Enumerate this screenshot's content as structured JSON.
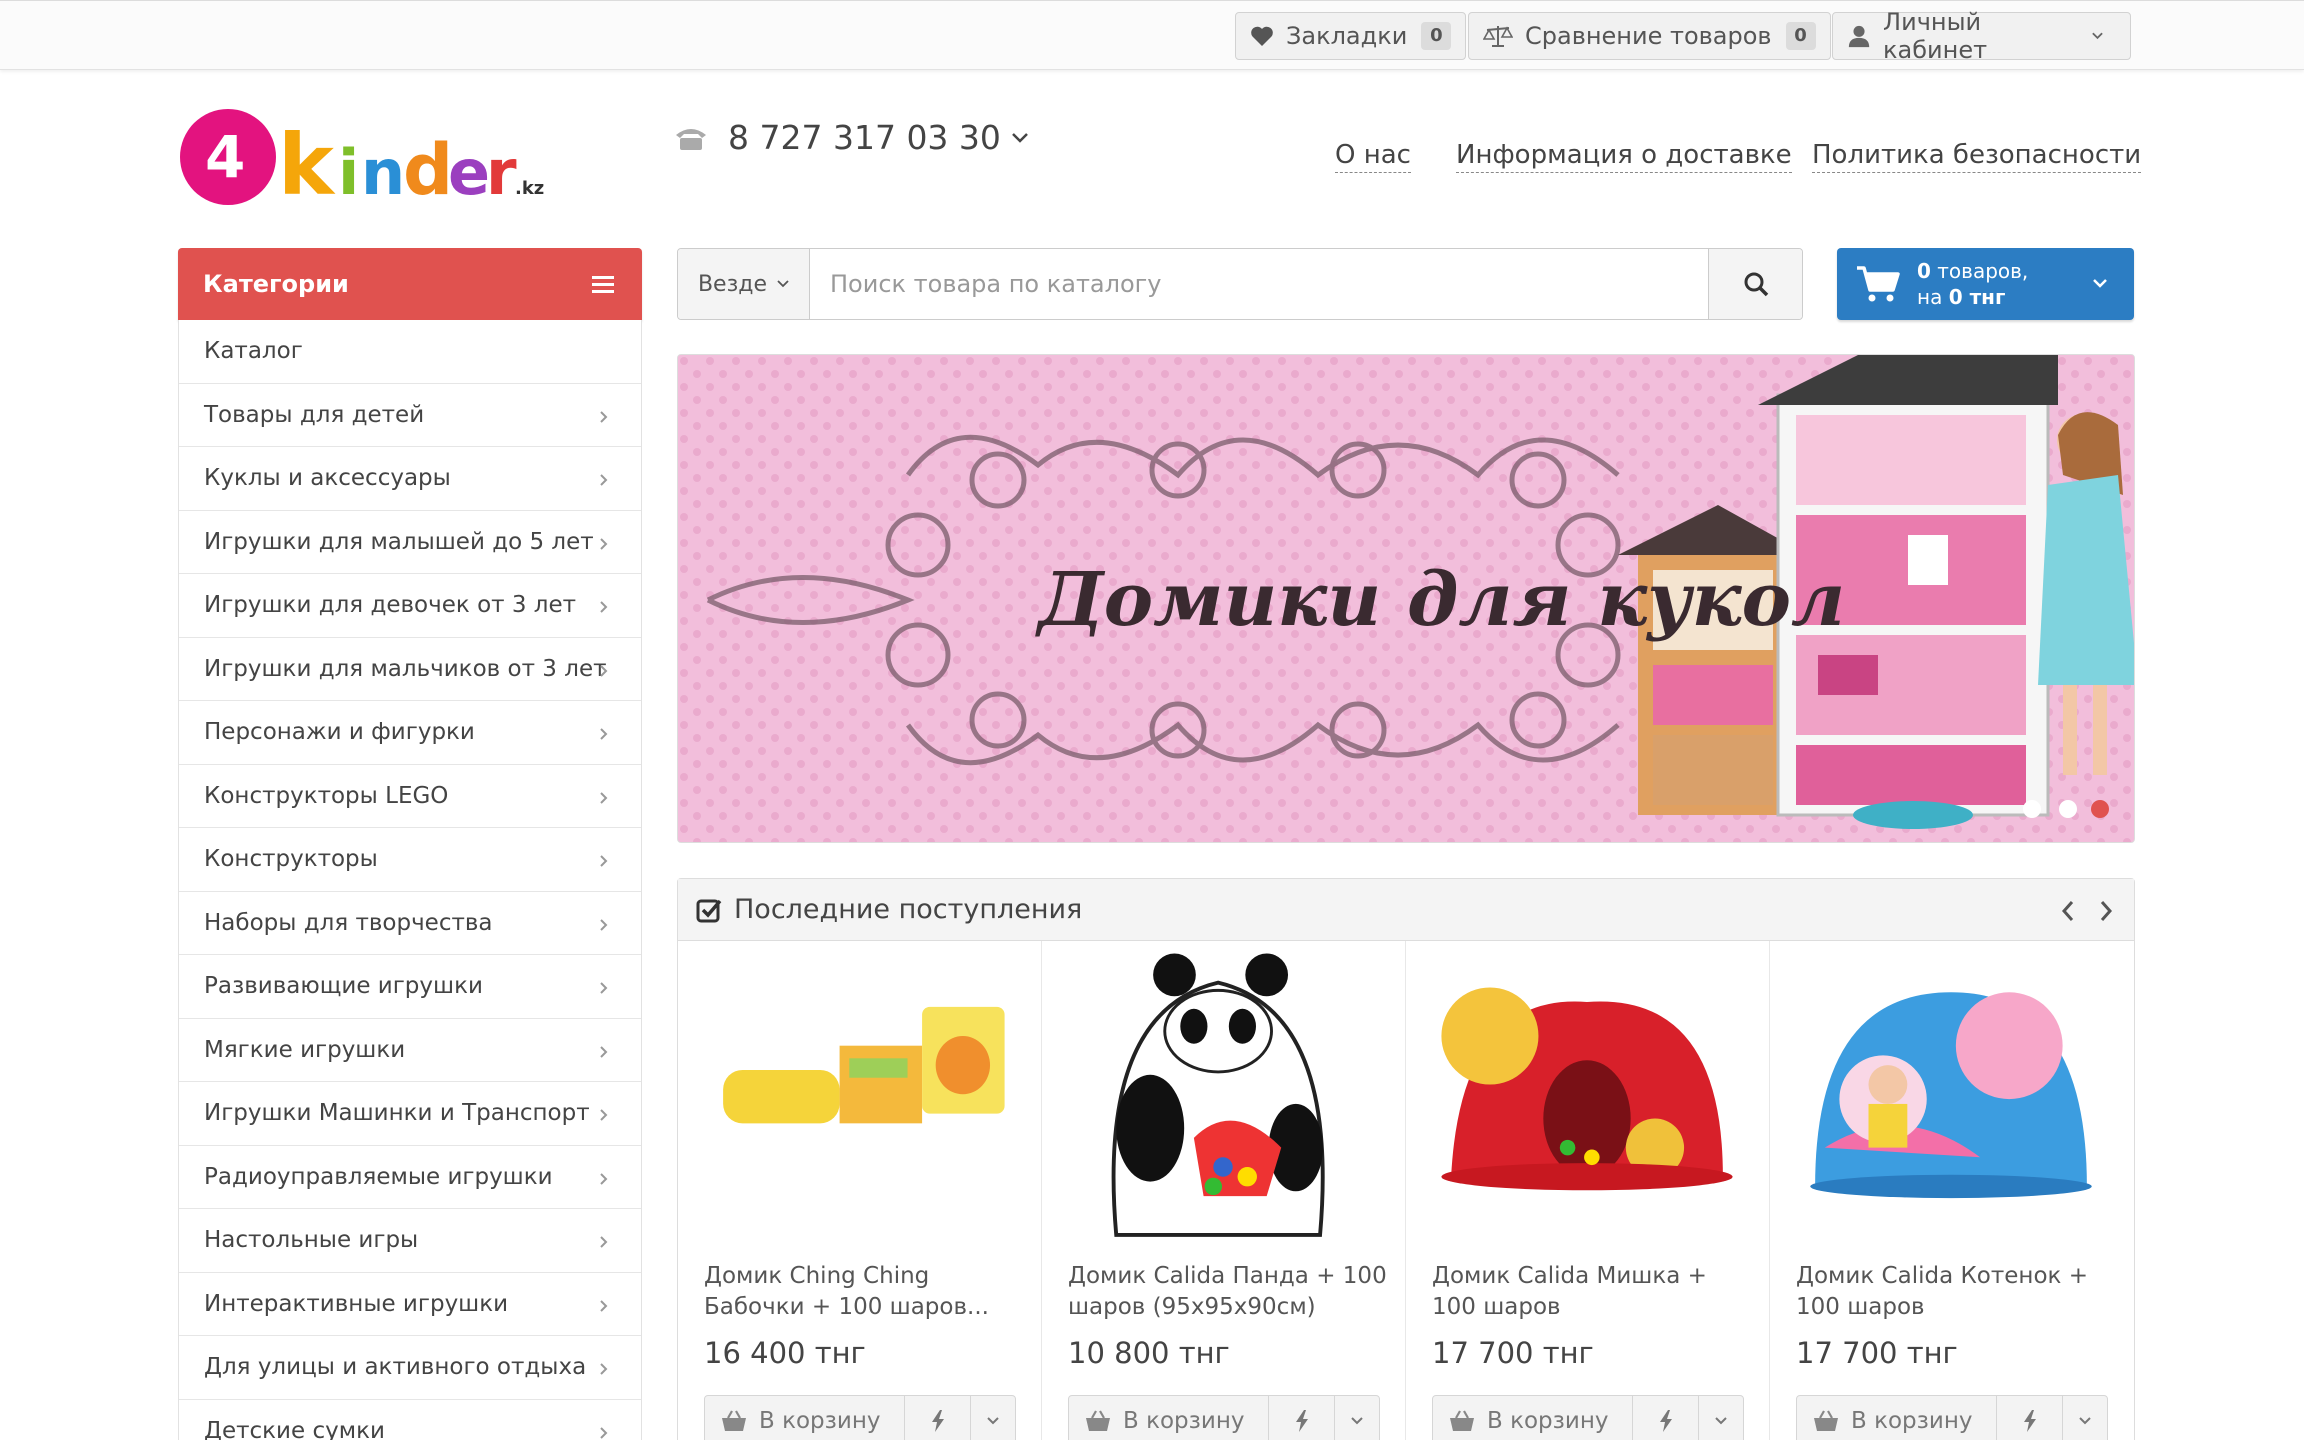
{
  "topbar": {
    "bookmarks": {
      "label": "Закладки",
      "count": "0",
      "icon": "heart-icon"
    },
    "compare": {
      "label": "Сравнение товаров",
      "count": "0",
      "icon": "scales-icon"
    },
    "account": {
      "label": "Личный кабинет",
      "icon": "user-icon"
    }
  },
  "header": {
    "logo_text": "4kinder.kz",
    "phone": "8 727 317 03 30",
    "nav": [
      "О нас",
      "Информация о доставке",
      "Политика безопасности"
    ]
  },
  "sidebar": {
    "title": "Категории",
    "items": [
      {
        "label": "Каталог",
        "has_arrow": false
      },
      {
        "label": "Товары для детей",
        "has_arrow": true
      },
      {
        "label": "Куклы и аксессуары",
        "has_arrow": true
      },
      {
        "label": "Игрушки для малышей до 5 лет",
        "has_arrow": true
      },
      {
        "label": "Игрушки для девочек от 3 лет",
        "has_arrow": true
      },
      {
        "label": "Игрушки для мальчиков от 3 лет",
        "has_arrow": true
      },
      {
        "label": "Персонажи и фигурки",
        "has_arrow": true
      },
      {
        "label": "Конструкторы LEGO",
        "has_arrow": true
      },
      {
        "label": "Конструкторы",
        "has_arrow": true
      },
      {
        "label": "Наборы для творчества",
        "has_arrow": true
      },
      {
        "label": "Развивающие игрушки",
        "has_arrow": true
      },
      {
        "label": "Мягкие игрушки",
        "has_arrow": true
      },
      {
        "label": "Игрушки Машинки и Транспорт",
        "has_arrow": true
      },
      {
        "label": "Радиоуправляемые игрушки",
        "has_arrow": true
      },
      {
        "label": "Настольные игры",
        "has_arrow": true
      },
      {
        "label": "Интерактивные игрушки",
        "has_arrow": true
      },
      {
        "label": "Для улицы и активного отдыха",
        "has_arrow": true
      },
      {
        "label": "Детские сумки",
        "has_arrow": true
      }
    ]
  },
  "search": {
    "scope": "Везде",
    "placeholder": "Поиск товара по каталогу"
  },
  "cart": {
    "count": "0",
    "count_label": "товаров,",
    "total_prefix": "на",
    "total": "0 тнг"
  },
  "banner": {
    "title": "Домики для кукол",
    "slides": 3,
    "active_slide": 3
  },
  "latest": {
    "title": "Последние поступления",
    "products": [
      {
        "name": "Домик Ching Ching Бабочки + 100 шаров...",
        "price": "16 400 тнг",
        "add_label": "В корзину"
      },
      {
        "name": "Домик Calida Панда + 100 шаров (95х95х90см)",
        "price": "10 800 тнг",
        "add_label": "В корзину"
      },
      {
        "name": "Домик Calida Мишка + 100 шаров",
        "price": "17 700 тнг",
        "add_label": "В корзину"
      },
      {
        "name": "Домик Calida Котенок + 100 шаров",
        "price": "17 700 тнг",
        "add_label": "В корзину"
      }
    ]
  },
  "colors": {
    "accent_red": "#e0524f",
    "cart_blue": "#2c7dc3",
    "banner_pink": "#f0b7d7"
  }
}
